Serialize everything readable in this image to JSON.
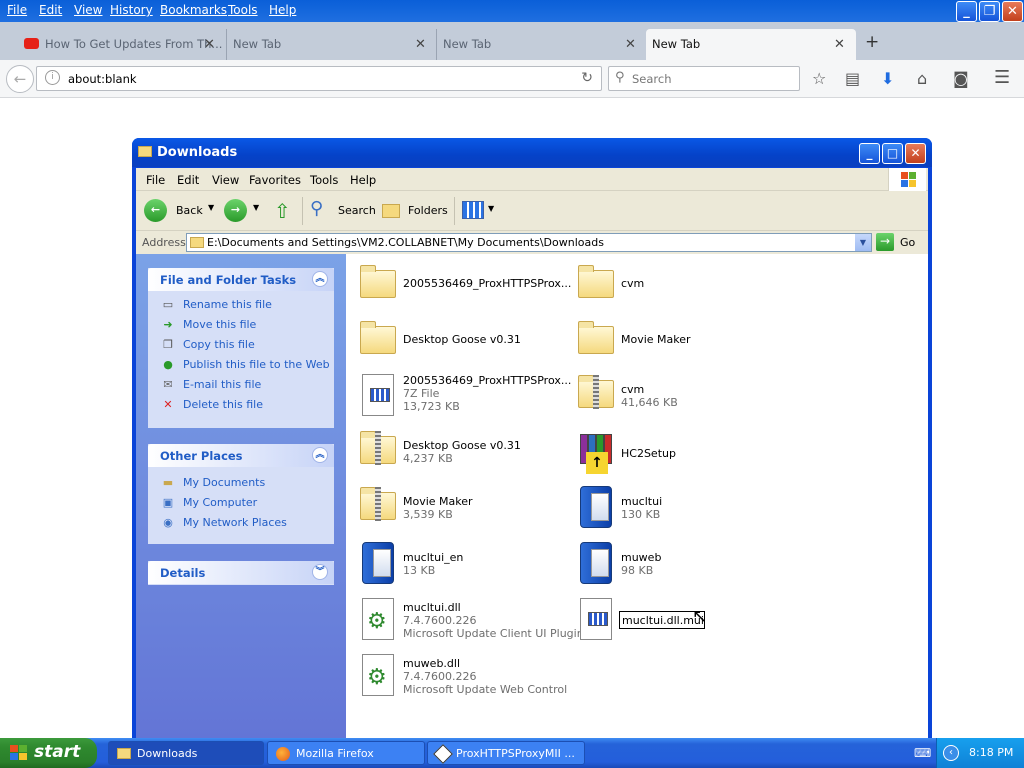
{
  "firefox": {
    "menu": [
      "File",
      "Edit",
      "View",
      "History",
      "Bookmarks",
      "Tools",
      "Help"
    ],
    "tabs": [
      {
        "label": "How To Get Updates From Th...",
        "icon": "youtube-icon"
      },
      {
        "label": "New Tab"
      },
      {
        "label": "New Tab"
      },
      {
        "label": "New Tab",
        "active": true
      }
    ],
    "new_tab_label": "+",
    "url": "about:blank",
    "search_placeholder": "Search"
  },
  "explorer": {
    "title": "Downloads",
    "menu": [
      "File",
      "Edit",
      "View",
      "Favorites",
      "Tools",
      "Help"
    ],
    "toolbar": {
      "back": "Back",
      "search": "Search",
      "folders": "Folders"
    },
    "address_label": "Address",
    "address": "E:\\Documents and Settings\\VM2.COLLABNET\\My Documents\\Downloads",
    "go_label": "Go",
    "file_tasks": {
      "title": "File and Folder Tasks",
      "items": [
        "Rename this file",
        "Move this file",
        "Copy this file",
        "Publish this file to the Web",
        "E-mail this file",
        "Delete this file"
      ]
    },
    "other_places": {
      "title": "Other Places",
      "items": [
        "My Documents",
        "My Computer",
        "My Network Places"
      ]
    },
    "details": {
      "title": "Details"
    },
    "files": [
      {
        "name": "2005536469_ProxHTTPSProx...",
        "type": "folder"
      },
      {
        "name": "cvm",
        "type": "folder"
      },
      {
        "name": "Desktop Goose v0.31",
        "type": "folder"
      },
      {
        "name": "Movie Maker",
        "type": "folder"
      },
      {
        "name": "2005536469_ProxHTTPSProx...",
        "line2": "7Z File",
        "line3": "13,723 KB",
        "type": "doc"
      },
      {
        "name": "cvm",
        "line2": "41,646 KB",
        "type": "zip"
      },
      {
        "name": "Desktop Goose v0.31",
        "line2": "4,237 KB",
        "type": "zip"
      },
      {
        "name": "HC2Setup",
        "type": "rar"
      },
      {
        "name": "Movie Maker",
        "line2": "3,539 KB",
        "type": "zip"
      },
      {
        "name": "mucltui",
        "line2": "130 KB",
        "type": "exe"
      },
      {
        "name": "mucltui_en",
        "line2": "13 KB",
        "type": "exe"
      },
      {
        "name": "muweb",
        "line2": "98 KB",
        "type": "exe"
      },
      {
        "name": "mucltui.dll",
        "line2": "7.4.7600.226",
        "line3": "Microsoft Update Client UI Plugin",
        "type": "dll"
      },
      {
        "name": "mucltui.dll.mui",
        "type": "doc",
        "renaming": true
      },
      {
        "name": "muweb.dll",
        "line2": "7.4.7600.226",
        "line3": "Microsoft Update Web Control",
        "type": "dll"
      }
    ]
  },
  "taskbar": {
    "start": "start",
    "tasks": [
      "Downloads",
      "Mozilla Firefox",
      "ProxHTTPSProxyMII ..."
    ],
    "clock": "8:18 PM"
  }
}
